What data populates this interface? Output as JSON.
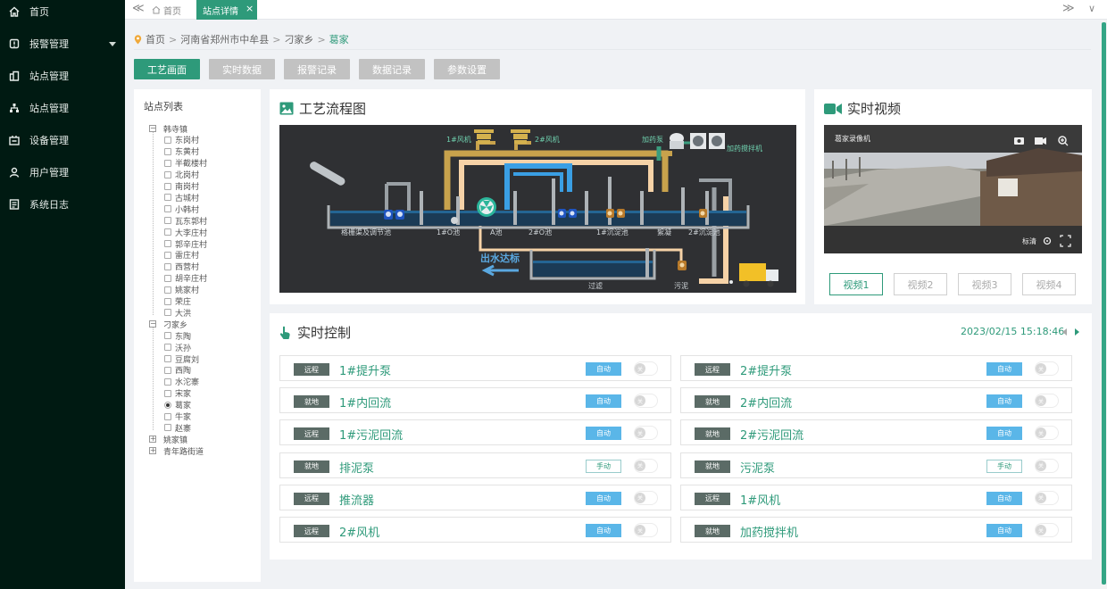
{
  "colors": {
    "accent": "#2e9a7a",
    "sidebar": "#001a12",
    "auto": "#5ab6e8",
    "pipe_yellow": "#c8a24c",
    "pipe_blue": "#3a9fe4",
    "pipe_peach": "#f6d2a7"
  },
  "sidebar": {
    "items": [
      {
        "label": "首页",
        "icon": "home-icon"
      },
      {
        "label": "报警管理",
        "icon": "alarm-icon",
        "expandable": true
      },
      {
        "label": "站点管理",
        "icon": "station-icon"
      },
      {
        "label": "站点管理",
        "icon": "sitemap-icon"
      },
      {
        "label": "设备管理",
        "icon": "device-icon"
      },
      {
        "label": "用户管理",
        "icon": "user-icon"
      },
      {
        "label": "系统日志",
        "icon": "log-icon"
      }
    ]
  },
  "tabs": {
    "home": "首页",
    "detail": "站点详情",
    "close": "×",
    "collapse": "≪",
    "more": "≫",
    "down": "∨"
  },
  "breadcrumb": {
    "items": [
      "首页",
      "河南省郑州市中牟县",
      "刁家乡"
    ],
    "current": "葛家",
    "sep": ">"
  },
  "toolbar": {
    "buttons": [
      "工艺画面",
      "实时数据",
      "报警记录",
      "数据记录",
      "参数设置"
    ],
    "active": 0
  },
  "station_list": {
    "title": "站点列表",
    "tree": [
      {
        "name": "韩寺镇",
        "expanded": true,
        "children": [
          "东岗村",
          "东黄村",
          "半截楼村",
          "北岗村",
          "南岗村",
          "古城村",
          "小韩村",
          "瓦东郭村",
          "大李庄村",
          "郭辛庄村",
          "雷庄村",
          "西营村",
          "胡辛庄村",
          "姚家村",
          "荣庄",
          "大洪"
        ]
      },
      {
        "name": "刁家乡",
        "expanded": true,
        "selected": "葛家",
        "children": [
          "东陶",
          "沃孙",
          "豆腐刘",
          "西陶",
          "水沱寨",
          "宋家",
          "葛家",
          "牛家",
          "赵寨"
        ]
      },
      {
        "name": "姚家镇",
        "expanded": false,
        "children": []
      },
      {
        "name": "青年路街道",
        "expanded": false,
        "children": []
      }
    ]
  },
  "process": {
    "title": "工艺流程图",
    "labels": {
      "fan1": "1#风机",
      "fan2": "2#风机",
      "dosing": "加药泵",
      "mixer": "加药搅拌机",
      "tank_grease": "格栅渠及调节池",
      "tank_1_0": "1#O池",
      "tank_a": "A池",
      "tank_2_0": "2#O池",
      "tank_settle1": "1#沉淀池",
      "tank_disinfect": "絮凝",
      "tank_settle2": "2#沉淀池",
      "outflow": "出水达标",
      "filter": "过滤",
      "sludge": "污泥"
    }
  },
  "video": {
    "title": "实时视频",
    "camera_name": "葛家录像机",
    "quality": "标清",
    "buttons": [
      "视频1",
      "视频2",
      "视频3",
      "视频4"
    ],
    "active": 0
  },
  "control": {
    "title": "实时控制",
    "timestamp": "2023/02/15 15:18:46",
    "switch_label": "关",
    "rows": [
      {
        "tag": "远程",
        "name": "1#提升泵",
        "mode": "自动",
        "manual": false
      },
      {
        "tag": "远程",
        "name": "2#提升泵",
        "mode": "自动",
        "manual": false
      },
      {
        "tag": "就地",
        "name": "1#内回流",
        "mode": "自动",
        "manual": false
      },
      {
        "tag": "就地",
        "name": "2#内回流",
        "mode": "自动",
        "manual": false
      },
      {
        "tag": "远程",
        "name": "1#污泥回流",
        "mode": "自动",
        "manual": false
      },
      {
        "tag": "就地",
        "name": "2#污泥回流",
        "mode": "自动",
        "manual": false
      },
      {
        "tag": "就地",
        "name": "排泥泵",
        "mode": "手动",
        "manual": true
      },
      {
        "tag": "就地",
        "name": "污泥泵",
        "mode": "手动",
        "manual": true
      },
      {
        "tag": "远程",
        "name": "推流器",
        "mode": "自动",
        "manual": false
      },
      {
        "tag": "远程",
        "name": "1#风机",
        "mode": "自动",
        "manual": false
      },
      {
        "tag": "远程",
        "name": "2#风机",
        "mode": "自动",
        "manual": false
      },
      {
        "tag": "就地",
        "name": "加药搅拌机",
        "mode": "自动",
        "manual": false
      }
    ]
  }
}
